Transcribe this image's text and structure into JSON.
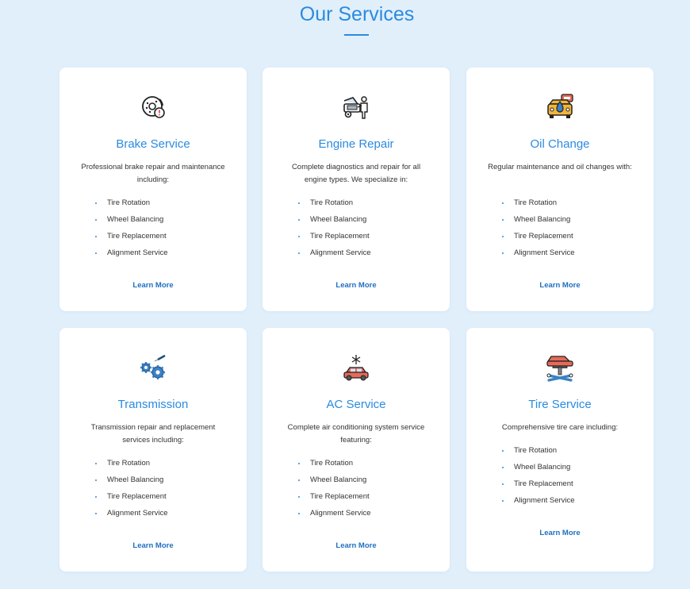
{
  "section": {
    "title": "Our Services"
  },
  "services": [
    {
      "title": "Brake Service",
      "desc": "Professional brake repair and maintenance including:",
      "items": [
        "Tire Rotation",
        "Wheel Balancing",
        "Tire Replacement",
        "Alignment Service"
      ],
      "link": "Learn More",
      "icon": "brake-disc-icon"
    },
    {
      "title": "Engine Repair",
      "desc": "Complete diagnostics and repair for all engine types. We specialize in:",
      "items": [
        "Tire Rotation",
        "Wheel Balancing",
        "Tire Replacement",
        "Alignment Service"
      ],
      "link": "Learn More",
      "icon": "mechanic-car-icon"
    },
    {
      "title": "Oil Change",
      "desc": "Regular maintenance and oil changes with:",
      "items": [
        "Tire Rotation",
        "Wheel Balancing",
        "Tire Replacement",
        "Alignment Service"
      ],
      "link": "Learn More",
      "icon": "oil-change-car-icon"
    },
    {
      "title": "Transmission",
      "desc": "Transmission repair and replacement services including:",
      "items": [
        "Tire Rotation",
        "Wheel Balancing",
        "Tire Replacement",
        "Alignment Service"
      ],
      "link": "Learn More",
      "icon": "gears-icon"
    },
    {
      "title": "AC Service",
      "desc": "Complete air conditioning system service featuring:",
      "items": [
        "Tire Rotation",
        "Wheel Balancing",
        "Tire Replacement",
        "Alignment Service"
      ],
      "link": "Learn More",
      "icon": "ac-car-icon"
    },
    {
      "title": "Tire Service",
      "desc": "Comprehensive tire care including:",
      "items": [
        "Tire Rotation",
        "Wheel Balancing",
        "Tire Replacement",
        "Alignment Service"
      ],
      "link": "Learn More",
      "icon": "car-lift-icon"
    }
  ],
  "colors": {
    "accent": "#2a8be0",
    "link": "#1f6fc0",
    "background": "#e1effb",
    "card": "#ffffff"
  }
}
